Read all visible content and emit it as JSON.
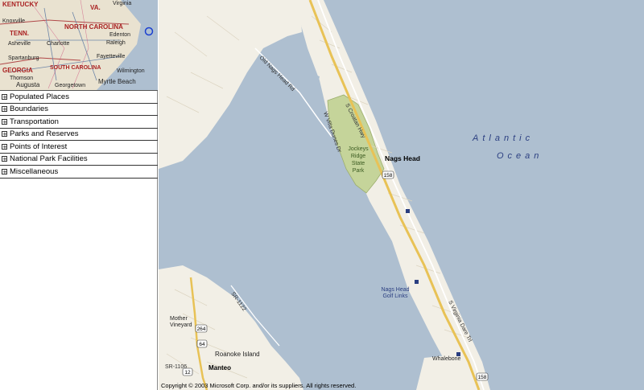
{
  "overview": {
    "labels": [
      "KENTUCKY",
      "VA.",
      "Virginia",
      "Knoxville",
      "NORTH CAROLINA",
      "TENN.",
      "Asheville",
      "Charlotte",
      "Raleigh",
      "Fayetteville",
      "Edenton",
      "Spartanburg",
      "GEORGIA",
      "SOUTH CAROLINA",
      "Augusta",
      "Thomson",
      "Georgetown",
      "Myrtle Beach",
      "Wilmington"
    ]
  },
  "layers": [
    {
      "label": "Populated Places"
    },
    {
      "label": "Boundaries"
    },
    {
      "label": "Transportation"
    },
    {
      "label": "Parks and Reserves"
    },
    {
      "label": "Points of Interest"
    },
    {
      "label": "National Park Facilities"
    },
    {
      "label": "Miscellaneous"
    }
  ],
  "map": {
    "ocean_label_1": "Atlantic",
    "ocean_label_2": "Ocean",
    "park_line1": "Jockeys",
    "park_line2": "Ridge",
    "park_line3": "State",
    "park_line4": "Park",
    "town_nags_head": "Nags Head",
    "golf": "Nags Head Golf Links",
    "golf_line1": "Nags Head",
    "golf_line2": "Golf Links",
    "roanoke_island": "Roanoke Island",
    "manteo": "Manteo",
    "mother_vineyard_1": "Mother",
    "mother_vineyard_2": "Vineyard",
    "whalebone": "Whalebone",
    "road_croatan": "S Croatan Hwy",
    "road_virginia_dare": "S Virginia Dare Trl",
    "road_old_nags_head": "Old Nags Head Rd",
    "road_wrightsville": "W Villa Dunes Dr",
    "road_sr1122": "SR-1122",
    "road_sr1106": "SR-1106",
    "shield_158": "158",
    "shield_158b": "158",
    "shield_264": "264",
    "shield_64": "64",
    "shield_12": "12",
    "copyright": "Copyright © 2003 Microsoft Corp. and/or its suppliers. All rights reserved.",
    "colors": {
      "water": "#aebfd0",
      "land": "#f2efe6",
      "park": "#c5d49a",
      "road": "#e8c256"
    }
  }
}
